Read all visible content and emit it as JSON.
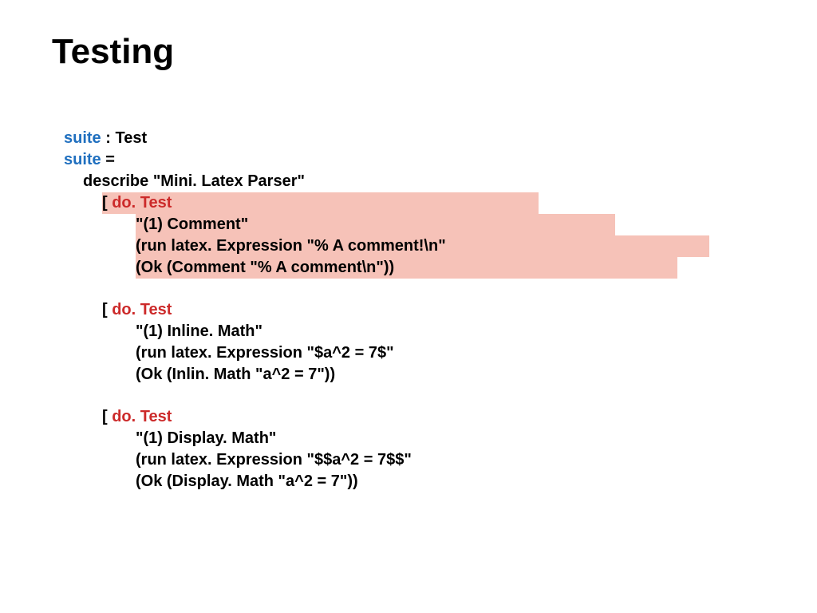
{
  "title": "Testing",
  "code": {
    "sig_kw": "suite",
    "sig_rest": " : Test",
    "assign_kw": "suite",
    "assign_rest": " =",
    "describe": "describe \"Mini. Latex Parser\"",
    "tests": [
      {
        "highlight": true,
        "bracket": "[ ",
        "do": "do. Test",
        "name": "\"(1) Comment\"",
        "run": "(run latex. Expression \"% A comment!\\n\"",
        "ok": "(Ok (Comment \"% A comment\\n\"))"
      },
      {
        "highlight": false,
        "bracket": "[ ",
        "do": "do. Test",
        "name": "\"(1) Inline. Math\"",
        "run": "(run latex. Expression \"$a^2 = 7$\"",
        "ok": "(Ok (Inlin. Math \"a^2 = 7\"))"
      },
      {
        "highlight": false,
        "bracket": "[ ",
        "do": "do. Test",
        "name": "\"(1) Display. Math\"",
        "run": "(run latex. Expression \"$$a^2 = 7$$\"",
        "ok": "(Ok (Display. Math \"a^2 = 7\"))"
      }
    ]
  }
}
